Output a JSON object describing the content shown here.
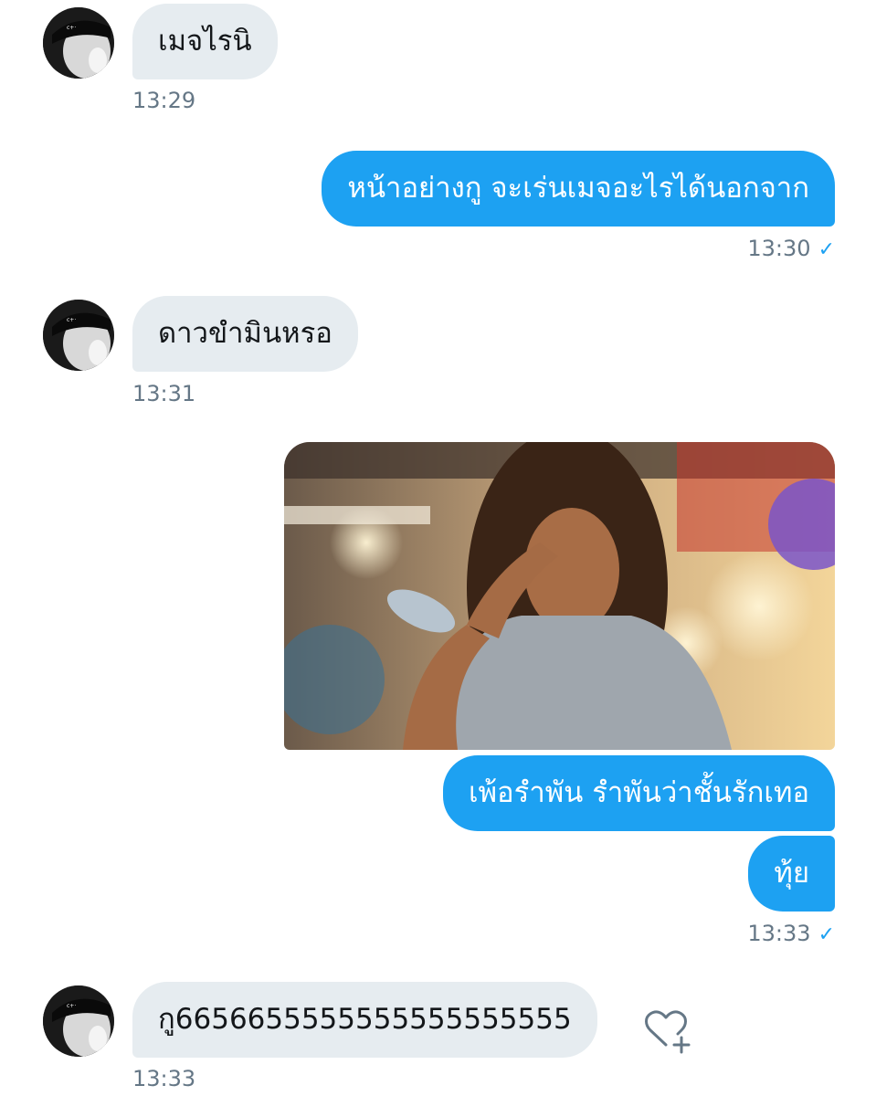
{
  "messages": [
    {
      "side": "in",
      "text": "เมจไรนิ",
      "time": "13:29"
    },
    {
      "side": "out",
      "text": "หน้าอย่างกู จะเร่นเมจอะไรได้นอกจาก",
      "time": "13:30",
      "status_icon": "check-icon"
    },
    {
      "side": "in",
      "text": "ดาวขำมินหรอ",
      "time": "13:31"
    },
    {
      "side": "out",
      "media": "photo",
      "text": "เพ้อรำพัน รำพันว่าชั้นรักเทอ"
    },
    {
      "side": "out",
      "text": "ทุ้ย",
      "time": "13:33",
      "status_icon": "check-icon"
    },
    {
      "side": "in",
      "text": "กู6656655555555555555555",
      "time": "13:33",
      "action_icon": "heart-add-icon"
    }
  ],
  "colors": {
    "outgoing_bubble": "#1da1f2",
    "incoming_bubble": "#e6ecf0",
    "timestamp": "#657786",
    "check": "#1da1f2"
  }
}
